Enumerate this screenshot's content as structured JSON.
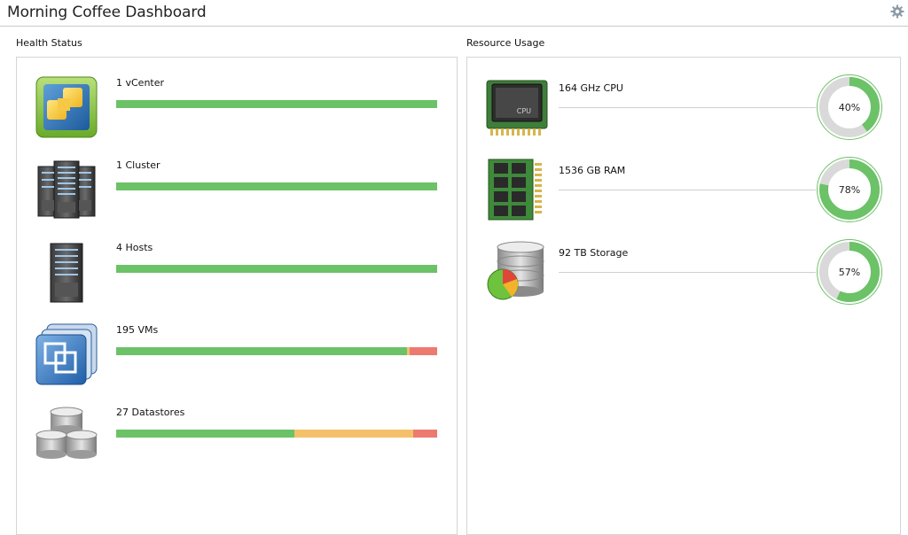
{
  "app": {
    "title": "Morning Coffee Dashboard",
    "settings_icon": "gear-icon"
  },
  "colors": {
    "green": "#6cc267",
    "yellow": "#f4c16a",
    "red": "#ec7a70",
    "gauge_track": "#d9d9d9"
  },
  "health": {
    "title": "Health Status",
    "items": [
      {
        "label": "1 vCenter",
        "icon": "vcenter-icon",
        "segments": [
          {
            "status": "ok",
            "fraction": 1.0
          }
        ]
      },
      {
        "label": "1 Cluster",
        "icon": "cluster-icon",
        "segments": [
          {
            "status": "ok",
            "fraction": 1.0
          }
        ]
      },
      {
        "label": "4 Hosts",
        "icon": "host-icon",
        "segments": [
          {
            "status": "ok",
            "fraction": 1.0
          }
        ]
      },
      {
        "label": "195 VMs",
        "icon": "vms-icon",
        "segments": [
          {
            "status": "ok",
            "fraction": 0.905
          },
          {
            "status": "warning",
            "fraction": 0.008
          },
          {
            "status": "critical",
            "fraction": 0.087
          }
        ]
      },
      {
        "label": "27 Datastores",
        "icon": "datastore-icon",
        "segments": [
          {
            "status": "ok",
            "fraction": 0.556
          },
          {
            "status": "warning",
            "fraction": 0.37
          },
          {
            "status": "critical",
            "fraction": 0.074
          }
        ]
      }
    ]
  },
  "resources": {
    "title": "Resource Usage",
    "items": [
      {
        "label": "164 GHz CPU",
        "icon": "cpu-icon",
        "percent": 40,
        "percent_text": "40%",
        "chip_text": "CPU"
      },
      {
        "label": "1536 GB RAM",
        "icon": "ram-icon",
        "percent": 78,
        "percent_text": "78%"
      },
      {
        "label": "92 TB Storage",
        "icon": "storage-icon",
        "percent": 57,
        "percent_text": "57%"
      }
    ]
  }
}
